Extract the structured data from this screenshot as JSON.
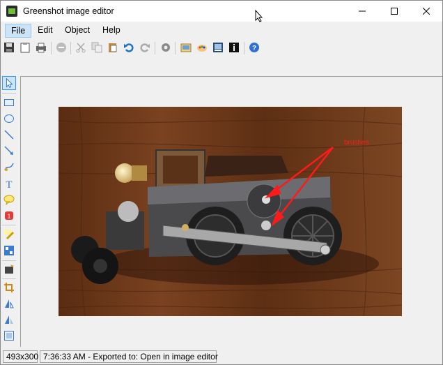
{
  "window": {
    "title": "Greenshot image editor"
  },
  "menu": {
    "file": "File",
    "edit": "Edit",
    "object": "Object",
    "help": "Help"
  },
  "toolbar": {
    "icons": [
      "save-icon",
      "clipboard-icon",
      "print-icon",
      "delete-icon",
      "cut-icon",
      "copy-icon",
      "paste-icon",
      "undo-icon",
      "redo-icon",
      "settings-icon",
      "export-icon",
      "paint-icon",
      "edit-image-icon",
      "info-icon",
      "help-icon"
    ]
  },
  "tools": {
    "icons": [
      "cursor-icon",
      "rectangle-icon",
      "ellipse-icon",
      "line-icon",
      "arrow-icon",
      "freehand-icon",
      "text-icon",
      "speechbubble-icon",
      "counter-icon",
      "highlight-icon",
      "obfuscate-icon",
      "effects-icon",
      "crop-icon",
      "rotate-icon",
      "resize-icon",
      "border-icon"
    ]
  },
  "image": {
    "annotation_text": "brushes",
    "annotation_color": "#ff1a1a"
  },
  "status": {
    "size": "493x300",
    "message": "7:36:33 AM - Exported to: Open in image editor"
  }
}
